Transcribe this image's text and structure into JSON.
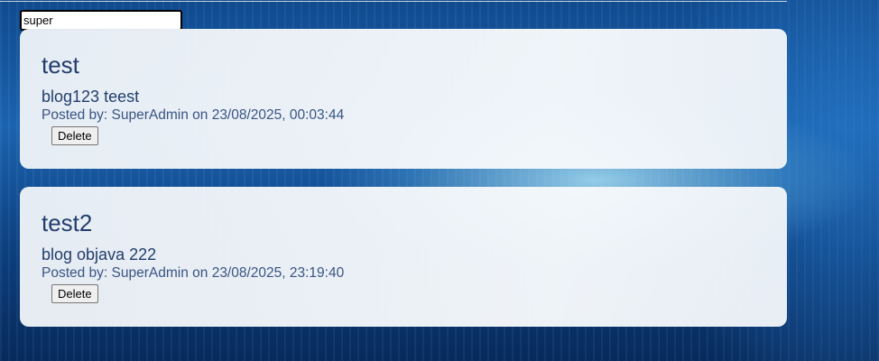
{
  "search": {
    "value": "super"
  },
  "posts": [
    {
      "title": "test",
      "body": "blog123 teest",
      "meta": "Posted by: SuperAdmin on 23/08/2025, 00:03:44",
      "delete_label": "Delete"
    },
    {
      "title": "test2",
      "body": "blog objava 222",
      "meta": "Posted by: SuperAdmin on 23/08/2025, 23:19:40",
      "delete_label": "Delete"
    }
  ],
  "colors": {
    "card_text": "#223d6c",
    "meta_text": "#3a5483",
    "page_background": "#1b63b0"
  }
}
